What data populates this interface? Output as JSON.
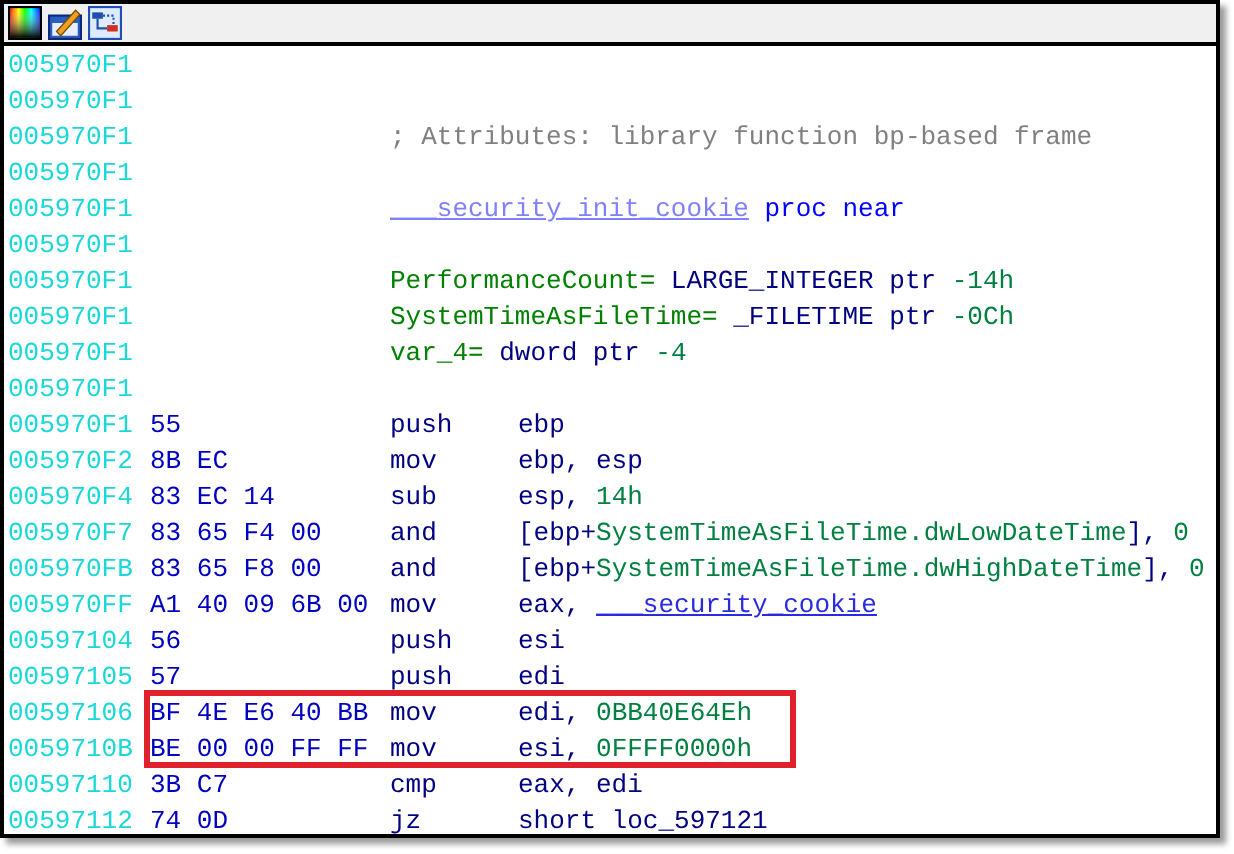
{
  "toolbar": {
    "buttons": [
      {
        "kind": "palette"
      },
      {
        "kind": "edit"
      },
      {
        "kind": "graph"
      }
    ]
  },
  "lines": [
    {
      "kind": "blank",
      "address": "005970F1"
    },
    {
      "kind": "blank",
      "address": "005970F1"
    },
    {
      "kind": "decl",
      "address": "005970F1",
      "body": [
        {
          "text": "; Attributes: library function bp-based frame",
          "kind": "comment"
        }
      ]
    },
    {
      "kind": "blank",
      "address": "005970F1"
    },
    {
      "kind": "decl",
      "address": "005970F1",
      "body": [
        {
          "text": "___security_init_cookie",
          "kind": "funcname"
        },
        {
          "text": " proc near",
          "kind": "keyword"
        }
      ]
    },
    {
      "kind": "blank",
      "address": "005970F1"
    },
    {
      "kind": "decl",
      "address": "005970F1",
      "body": [
        {
          "text": "PerformanceCount=",
          "kind": "varname"
        },
        {
          "text": " LARGE_INTEGER ptr ",
          "kind": "type"
        },
        {
          "text": "-14h",
          "kind": "number"
        }
      ]
    },
    {
      "kind": "decl",
      "address": "005970F1",
      "body": [
        {
          "text": "SystemTimeAsFileTime=",
          "kind": "varname"
        },
        {
          "text": " _FILETIME ptr ",
          "kind": "type"
        },
        {
          "text": "-0Ch",
          "kind": "number"
        }
      ]
    },
    {
      "kind": "decl",
      "address": "005970F1",
      "body": [
        {
          "text": "var_4=",
          "kind": "varname"
        },
        {
          "text": " dword ptr ",
          "kind": "type"
        },
        {
          "text": "-4",
          "kind": "number"
        }
      ]
    },
    {
      "kind": "blank",
      "address": "005970F1"
    },
    {
      "kind": "insn",
      "address": "005970F1",
      "bytes": "55",
      "mnemonic": "push",
      "highlighted": false,
      "body": [
        {
          "text": "ebp",
          "kind": "type"
        }
      ]
    },
    {
      "kind": "insn",
      "address": "005970F2",
      "bytes": "8B EC",
      "mnemonic": "mov",
      "highlighted": false,
      "body": [
        {
          "text": "ebp, esp",
          "kind": "type"
        }
      ]
    },
    {
      "kind": "insn",
      "address": "005970F4",
      "bytes": "83 EC 14",
      "mnemonic": "sub",
      "highlighted": false,
      "body": [
        {
          "text": "esp, ",
          "kind": "type"
        },
        {
          "text": "14h",
          "kind": "number"
        }
      ]
    },
    {
      "kind": "insn",
      "address": "005970F7",
      "bytes": "83 65 F4 00",
      "mnemonic": "and",
      "highlighted": false,
      "body": [
        {
          "text": "[ebp+",
          "kind": "type"
        },
        {
          "text": "SystemTimeAsFileTime.dwLowDateTime",
          "kind": "number"
        },
        {
          "text": "], ",
          "kind": "type"
        },
        {
          "text": "0",
          "kind": "number"
        }
      ]
    },
    {
      "kind": "insn",
      "address": "005970FB",
      "bytes": "83 65 F8 00",
      "mnemonic": "and",
      "highlighted": false,
      "body": [
        {
          "text": "[ebp+",
          "kind": "type"
        },
        {
          "text": "SystemTimeAsFileTime.dwHighDateTime",
          "kind": "number"
        },
        {
          "text": "], ",
          "kind": "type"
        },
        {
          "text": "0",
          "kind": "number"
        }
      ]
    },
    {
      "kind": "insn",
      "address": "005970FF",
      "bytes": "A1 40 09 6B 00",
      "mnemonic": "mov",
      "highlighted": false,
      "body": [
        {
          "text": "eax, ",
          "kind": "type"
        },
        {
          "text": "___security_cookie",
          "kind": "symbol"
        }
      ]
    },
    {
      "kind": "insn",
      "address": "00597104",
      "bytes": "56",
      "mnemonic": "push",
      "highlighted": false,
      "body": [
        {
          "text": "esi",
          "kind": "type"
        }
      ]
    },
    {
      "kind": "insn",
      "address": "00597105",
      "bytes": "57",
      "mnemonic": "push",
      "highlighted": false,
      "body": [
        {
          "text": "edi",
          "kind": "type"
        }
      ]
    },
    {
      "kind": "insn",
      "address": "00597106",
      "bytes": "BF 4E E6 40 BB",
      "mnemonic": "mov",
      "highlighted": true,
      "body": [
        {
          "text": "edi, ",
          "kind": "type"
        },
        {
          "text": "0BB40E64Eh",
          "kind": "number"
        }
      ]
    },
    {
      "kind": "insn",
      "address": "0059710B",
      "bytes": "BE 00 00 FF FF",
      "mnemonic": "mov",
      "highlighted": true,
      "body": [
        {
          "text": "esi, ",
          "kind": "type"
        },
        {
          "text": "0FFFF0000h",
          "kind": "number"
        }
      ]
    },
    {
      "kind": "insn",
      "address": "00597110",
      "bytes": "3B C7",
      "mnemonic": "cmp",
      "highlighted": false,
      "body": [
        {
          "text": "eax, edi",
          "kind": "type"
        }
      ]
    },
    {
      "kind": "insn",
      "address": "00597112",
      "bytes": "74 0D",
      "mnemonic": "jz",
      "highlighted": false,
      "body": [
        {
          "text": "short loc_597121",
          "kind": "type"
        }
      ]
    }
  ]
}
